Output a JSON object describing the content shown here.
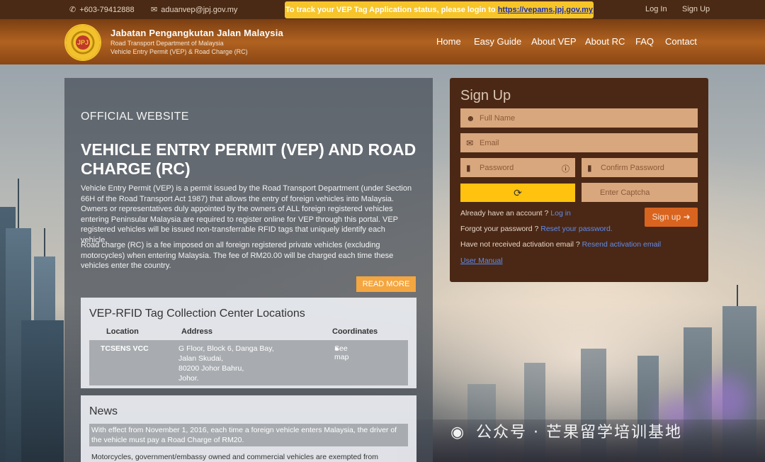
{
  "topbar": {
    "phone": "+603-79412888",
    "email": "aduanvep@jpj.gov.my",
    "track_text": "To track your VEP Tag Application status, please login to ",
    "track_link": "https://vepams.jpj.gov.my",
    "login": "Log In",
    "signup": "Sign Up"
  },
  "header": {
    "logo_text": "JPJ",
    "brand_title": "Jabatan Pengangkutan Jalan Malaysia",
    "brand_sub1": "Road Transport Department of Malaysia",
    "brand_sub2": "Vehicle Entry Permit (VEP) & Road Charge (RC)",
    "nav": [
      "Home",
      "Easy Guide",
      "About VEP",
      "About RC",
      "FAQ",
      "Contact"
    ]
  },
  "info": {
    "official": "OFFICIAL WEBSITE",
    "title": "VEHICLE ENTRY PERMIT (VEP) AND ROAD CHARGE (RC)",
    "para1": "Vehicle Entry Permit (VEP) is a permit issued by the Road Transport Department (under Section 66H of the Road Transport Act 1987) that allows the entry of foreign vehicles into Malaysia. Owners or representatives duly appointed by the owners of ALL foreign registered vehicles entering Peninsular Malaysia are required to register online for VEP through this portal. VEP registered vehicles will be issued non-transferrable RFID tags that uniquely identify each vehicle.",
    "para2": "Road charge (RC) is a fee imposed on all foreign registered private vehicles (excluding motorcycles) when entering Malaysia. The fee of RM20.00 will be charged each time these vehicles enter the country.",
    "read_more": "READ MORE"
  },
  "locations": {
    "title": "VEP-RFID Tag Collection Center Locations",
    "headers": [
      "Location",
      "Address",
      "Coordinates"
    ],
    "row": {
      "location": "TCSENS VCC",
      "address": [
        "G Floor, Block 6, Danga Bay,",
        "Jalan Skudai,",
        "80200 Johor Bahru,",
        "Johor."
      ],
      "coordinates": "See map"
    }
  },
  "news": {
    "title": "News",
    "item1": "With effect from November 1, 2016, each time a foreign vehicle enters Malaysia, the driver of the vehicle must pay a Road Charge of RM20.",
    "item2": "Motorcycles, government/embassy owned and commercial vehicles are exempted from"
  },
  "signup": {
    "title": "Sign Up",
    "full_name": "Full Name",
    "email": "Email",
    "password": "Password",
    "confirm_password": "Confirm Password",
    "captcha_placeholder": "Enter Captcha",
    "have_account": "Already have an account ?",
    "login": "Log in",
    "forgot": "Forgot your password ?",
    "reset": "Reset your password.",
    "no_activation": "Have not received activation email ?",
    "resend": "Resend activation email",
    "user_manual": "User Manual",
    "button": "Sign up"
  },
  "watermark": "公众号 · 芒果留学培训基地",
  "colors": {
    "topbar": "#4a2a14",
    "banner": "#f7c52a",
    "header": "#b06220",
    "signup_panel": "#4b2815",
    "field": "#d9a77e",
    "captcha": "#ffc20e",
    "signup_button": "#d9641f",
    "read_more": "#f4a640"
  }
}
